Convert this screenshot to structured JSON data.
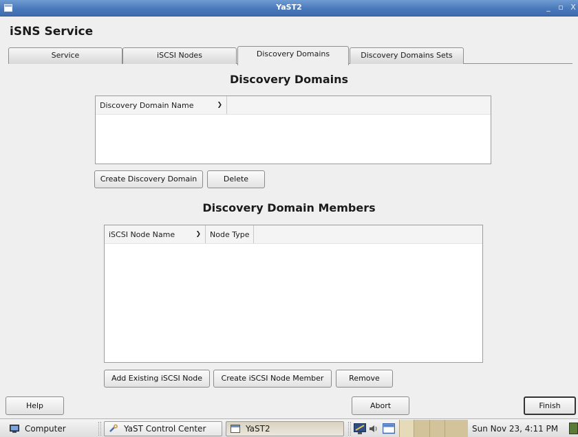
{
  "window": {
    "title": "YaST2",
    "controls": [
      "_",
      "▫",
      "X"
    ]
  },
  "page": {
    "title": "iSNS Service"
  },
  "tabs": [
    {
      "label": "Service",
      "active": false
    },
    {
      "label": "iSCSI Nodes",
      "active": false
    },
    {
      "label": "Discovery Domains",
      "active": true
    },
    {
      "label": "Discovery Domains Sets",
      "active": false
    }
  ],
  "domains": {
    "heading": "Discovery Domains",
    "columns": [
      "Discovery Domain Name"
    ],
    "rows": [],
    "create_label": "Create Discovery Domain",
    "delete_label": "Delete"
  },
  "members": {
    "heading": "Discovery Domain Members",
    "columns": [
      "iSCSI Node Name",
      "Node Type"
    ],
    "rows": [],
    "add_existing_label": "Add Existing iSCSI Node",
    "create_member_label": "Create iSCSI Node Member",
    "remove_label": "Remove"
  },
  "footer": {
    "help_label": "Help",
    "abort_label": "Abort",
    "finish_label": "Finish"
  },
  "taskbar": {
    "computer_label": "Computer",
    "yast_cc_label": "YaST Control Center",
    "yast2_label": "YaST2",
    "clock": "Sun Nov 23,  4:11 PM"
  },
  "icons": {
    "computer": "computer-icon",
    "control_center": "yast-control-center-icon",
    "window": "window-icon",
    "network": "network-icon",
    "volume": "volume-icon",
    "desktop": "show-desktop-icon"
  },
  "colors": {
    "titlebar": "#4a79bb",
    "background": "#efefef",
    "taskbar": "#dedede"
  }
}
